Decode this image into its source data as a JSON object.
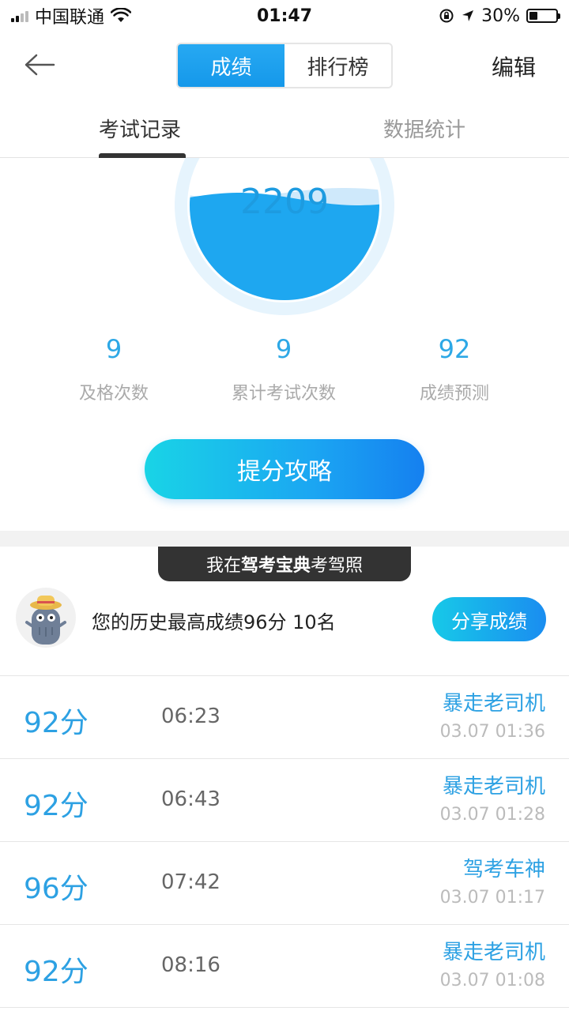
{
  "status_bar": {
    "carrier": "中国联通",
    "time": "01:47",
    "battery": "30%",
    "battery_level": 0.3
  },
  "header": {
    "segments": [
      {
        "label": "成绩",
        "active": true
      },
      {
        "label": "排行榜",
        "active": false
      }
    ],
    "edit_label": "编辑"
  },
  "tabs": [
    {
      "label": "考试记录",
      "active": true
    },
    {
      "label": "数据统计",
      "active": false
    }
  ],
  "gauge": {
    "score": "2209",
    "fill_level": 0.55
  },
  "stats": [
    {
      "value": "9",
      "label": "及格次数"
    },
    {
      "value": "9",
      "label": "累计考试次数"
    },
    {
      "value": "92",
      "label": "成绩预测"
    }
  ],
  "cta_label": "提分攻略",
  "banner": {
    "prefix": "我在",
    "highlight": "驾考宝典",
    "suffix": "考驾照"
  },
  "best": {
    "text": "您的历史最高成绩96分  10名",
    "share_label": "分享成绩"
  },
  "records": [
    {
      "score": "92分",
      "duration": "06:23",
      "title": "暴走老司机",
      "time": "03.07 01:36"
    },
    {
      "score": "92分",
      "duration": "06:43",
      "title": "暴走老司机",
      "time": "03.07 01:28"
    },
    {
      "score": "96分",
      "duration": "07:42",
      "title": "驾考车神",
      "time": "03.07 01:17"
    },
    {
      "score": "92分",
      "duration": "08:16",
      "title": "暴走老司机",
      "time": "03.07 01:08"
    }
  ],
  "colors": {
    "accent": "#1d9be0",
    "wave": "#1ea7f0",
    "ring": "#e6f4fd"
  }
}
